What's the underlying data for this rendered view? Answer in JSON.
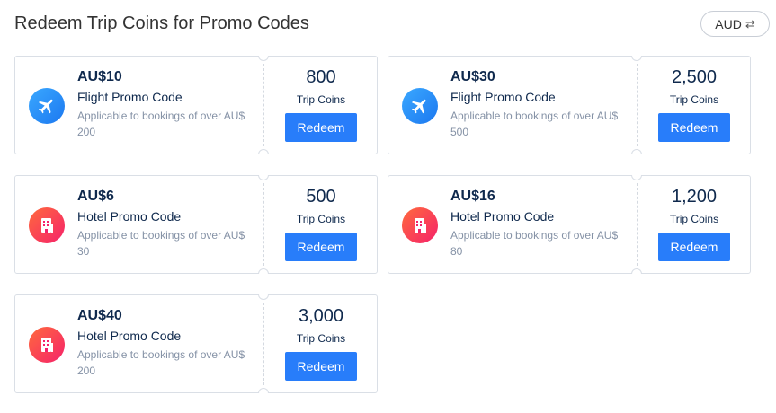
{
  "header": {
    "title": "Redeem Trip Coins for Promo Codes",
    "currency": "AUD",
    "currency_icon": "swap-arrows-icon"
  },
  "cards": [
    {
      "amount": "AU$10",
      "type": "Flight Promo Code",
      "desc_line1": "Applicable to bookings of over AU$",
      "desc_line2": "200",
      "coins": "800",
      "coins_label": "Trip Coins",
      "button": "Redeem",
      "icon": "airplane-icon"
    },
    {
      "amount": "AU$30",
      "type": "Flight Promo Code",
      "desc_line1": "Applicable to bookings of over AU$",
      "desc_line2": "500",
      "coins": "2,500",
      "coins_label": "Trip Coins",
      "button": "Redeem",
      "icon": "airplane-icon"
    },
    {
      "amount": "AU$6",
      "type": "Hotel Promo Code",
      "desc_line1": "Applicable to bookings of over AU$",
      "desc_line2": "30",
      "coins": "500",
      "coins_label": "Trip Coins",
      "button": "Redeem",
      "icon": "hotel-building-icon"
    },
    {
      "amount": "AU$16",
      "type": "Hotel Promo Code",
      "desc_line1": "Applicable to bookings of over AU$",
      "desc_line2": "80",
      "coins": "1,200",
      "coins_label": "Trip Coins",
      "button": "Redeem",
      "icon": "hotel-building-icon"
    },
    {
      "amount": "AU$40",
      "type": "Hotel Promo Code",
      "desc_line1": "Applicable to bookings of over AU$",
      "desc_line2": "200",
      "coins": "3,000",
      "coins_label": "Trip Coins",
      "button": "Redeem",
      "icon": "hotel-building-icon"
    }
  ],
  "colors": {
    "accent": "#287dfa",
    "flight_icon_bg": "#1c78f0",
    "hotel_icon_bg": "#f5226a",
    "text_primary": "#0f294d",
    "text_secondary": "#8592a6"
  }
}
